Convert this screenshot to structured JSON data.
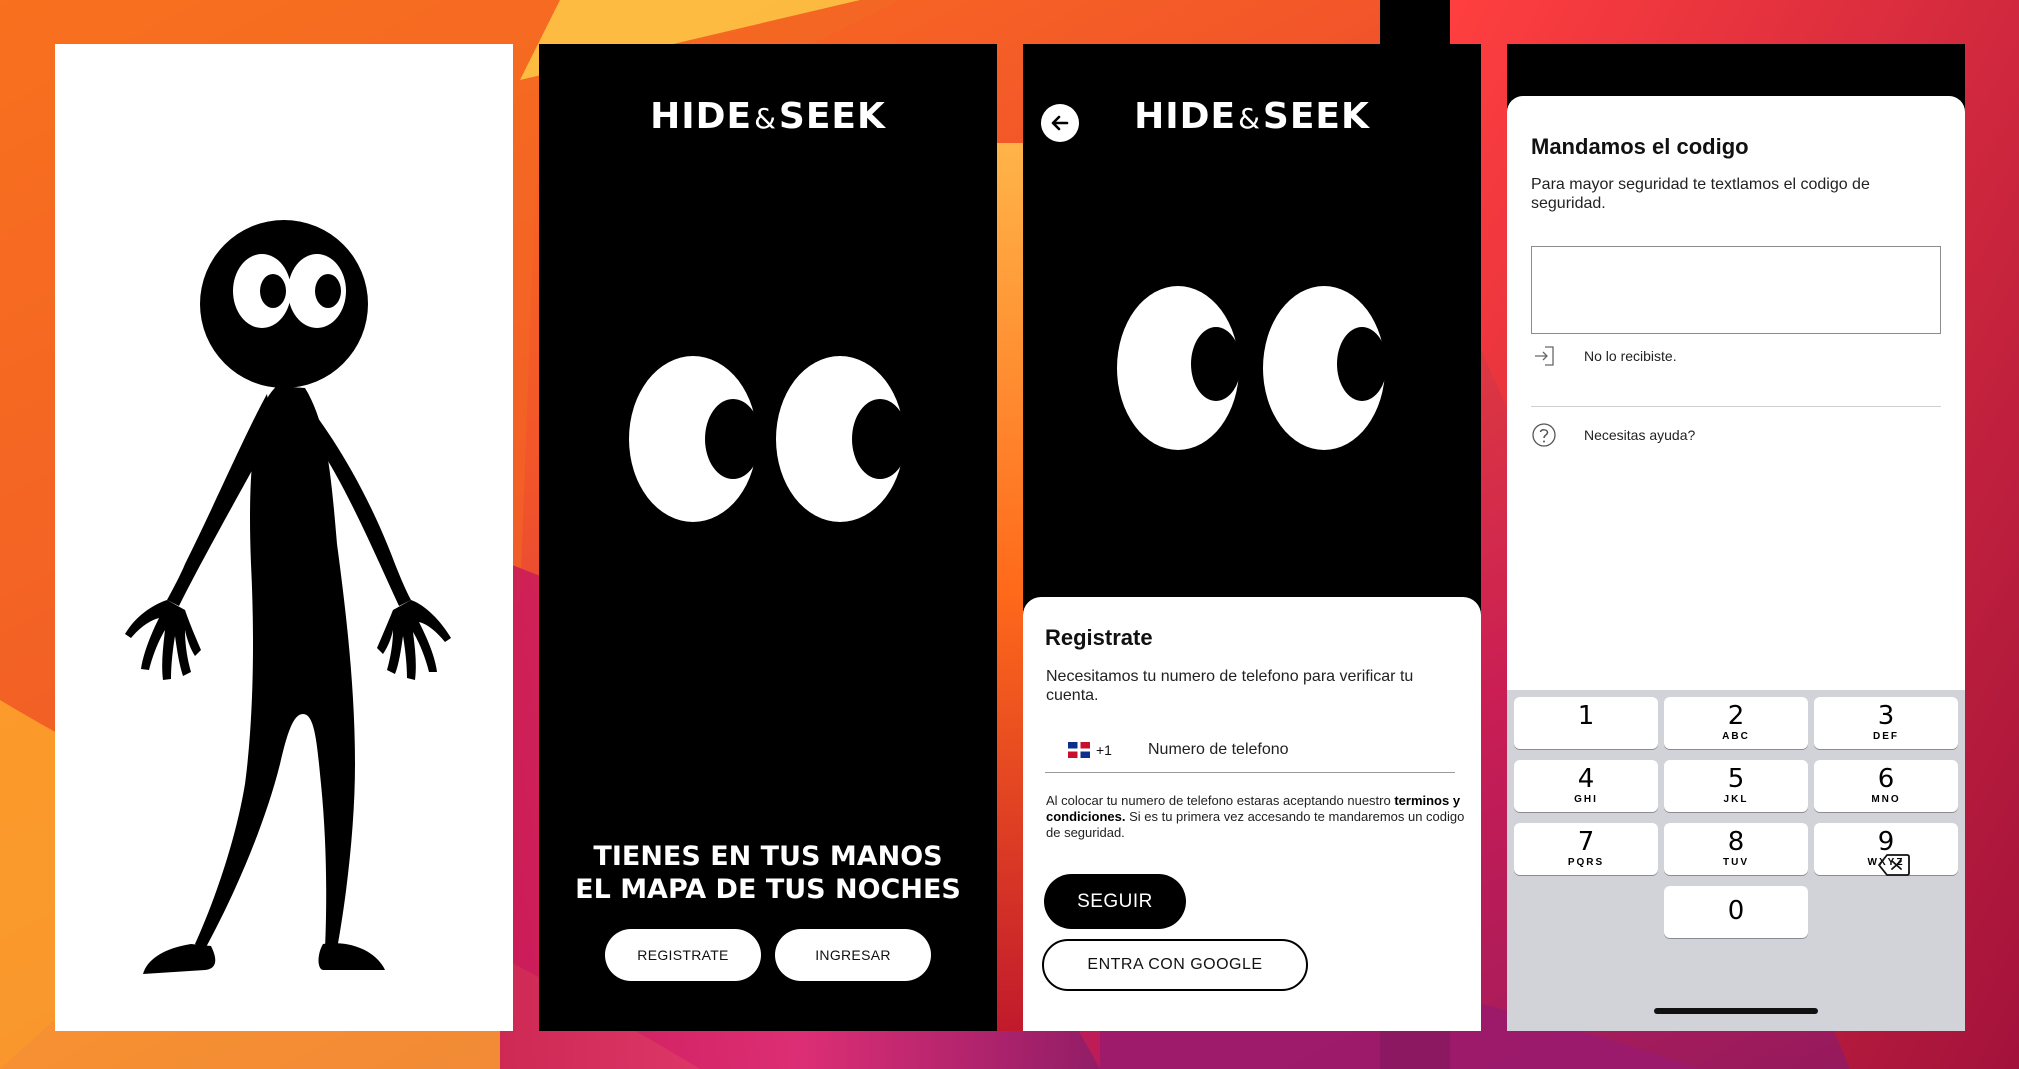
{
  "screen2": {
    "logo": {
      "left": "HIDE",
      "amp": "&",
      "right": "SEEK"
    },
    "slogan_line1": "TIENES EN TUS MANOS",
    "slogan_line2": "EL MAPA DE TUS NOCHES",
    "register_label": "REGISTRATE",
    "login_label": "INGRESAR"
  },
  "screen3": {
    "logo": {
      "left": "HIDE",
      "amp": "&",
      "right": "SEEK"
    },
    "title": "Registrate",
    "subtitle": "Necesitamos tu numero de telefono para verificar tu cuenta.",
    "country_code": "+1",
    "phone_placeholder": "Numero de telefono",
    "terms_before": "Al colocar tu numero de telefono estaras aceptando nuestro ",
    "terms_bold": "terminos y condiciones.",
    "terms_after": " Si es tu primera vez accesando te mandaremos un codigo de seguridad.",
    "continue_label": "SEGUIR",
    "google_label": "ENTRA CON GOOGLE"
  },
  "screen4": {
    "title": "Mandamos el codigo",
    "subtitle": "Para mayor seguridad te textlamos el codigo de seguridad.",
    "code_value": "",
    "resend_label": "No lo recibiste.",
    "help_label": "Necesitas ayuda?",
    "keys": [
      {
        "num": "1",
        "letters": ""
      },
      {
        "num": "2",
        "letters": "ABC"
      },
      {
        "num": "3",
        "letters": "DEF"
      },
      {
        "num": "4",
        "letters": "GHI"
      },
      {
        "num": "5",
        "letters": "JKL"
      },
      {
        "num": "6",
        "letters": "MNO"
      },
      {
        "num": "7",
        "letters": "PQRS"
      },
      {
        "num": "8",
        "letters": "TUV"
      },
      {
        "num": "9",
        "letters": "WXYZ"
      },
      {
        "num": "0",
        "letters": ""
      }
    ]
  },
  "icons": {
    "back": "arrow-left-icon",
    "flag": "dominican-flag-icon",
    "resend": "sign-in-icon",
    "help": "question-circle-icon",
    "delete": "backspace-icon"
  },
  "colors": {
    "background_gradient": [
      "#e23b1e",
      "#f7a52b",
      "#c21d5e",
      "#7a1f5c"
    ],
    "phone_black": "#000000",
    "sheet_white": "#ffffff",
    "keypad_gray": "#d2d3d8"
  }
}
